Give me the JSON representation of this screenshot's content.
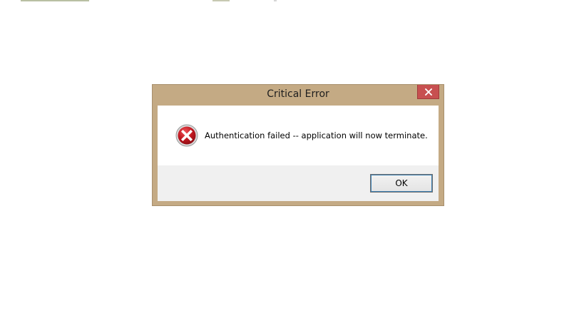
{
  "dialog": {
    "title": "Critical Error",
    "message": "Authentication failed -- application will now terminate.",
    "ok_label": "OK",
    "icons": {
      "close": "close-icon",
      "error": "error-icon"
    }
  },
  "colors": {
    "frame": "#c4aa84",
    "close_button": "#c75050",
    "error_icon": "#c0171f",
    "footer": "#f0f0f0"
  }
}
